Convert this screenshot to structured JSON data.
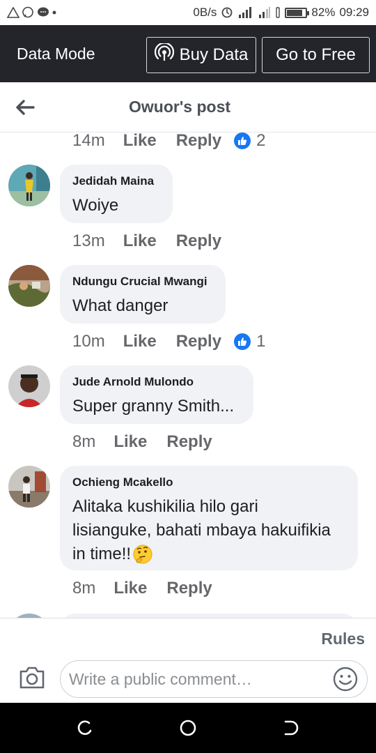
{
  "status_bar": {
    "speed": "0B/s",
    "battery": "82%",
    "battery_level": 0.82,
    "time": "09:29"
  },
  "data_bar": {
    "title": "Data Mode",
    "buy_label": "Buy Data",
    "free_label": "Go to Free"
  },
  "header": {
    "title": "Owuor's post"
  },
  "top_meta": {
    "time": "14m",
    "like": "Like",
    "reply": "Reply",
    "count": "2"
  },
  "comments": [
    {
      "author": "Jedidah Maina",
      "text": "Woiye",
      "time": "13m",
      "like": "Like",
      "reply": "Reply"
    },
    {
      "author": "Ndungu Crucial Mwangi",
      "text": "What danger",
      "time": "10m",
      "like": "Like",
      "reply": "Reply",
      "count": "1"
    },
    {
      "author": "Jude Arnold Mulondo",
      "text": "Super granny Smith...",
      "time": "8m",
      "like": "Like",
      "reply": "Reply"
    },
    {
      "author": "Ochieng Mcakello",
      "text_line1": "Alitaka kushikilia hilo gari",
      "text_line2": "lisianguke, bahati mbaya hakuifikia",
      "text_line3": "in time!!",
      "time": "8m",
      "like": "Like",
      "reply": "Reply"
    }
  ],
  "composer": {
    "rules": "Rules",
    "placeholder": "Write a public comment…"
  },
  "colors": {
    "data_bar_bg": "#23252a",
    "bubble_bg": "#f0f2f5",
    "like_blue": "#1877f2",
    "meta_grey": "#65676b"
  }
}
